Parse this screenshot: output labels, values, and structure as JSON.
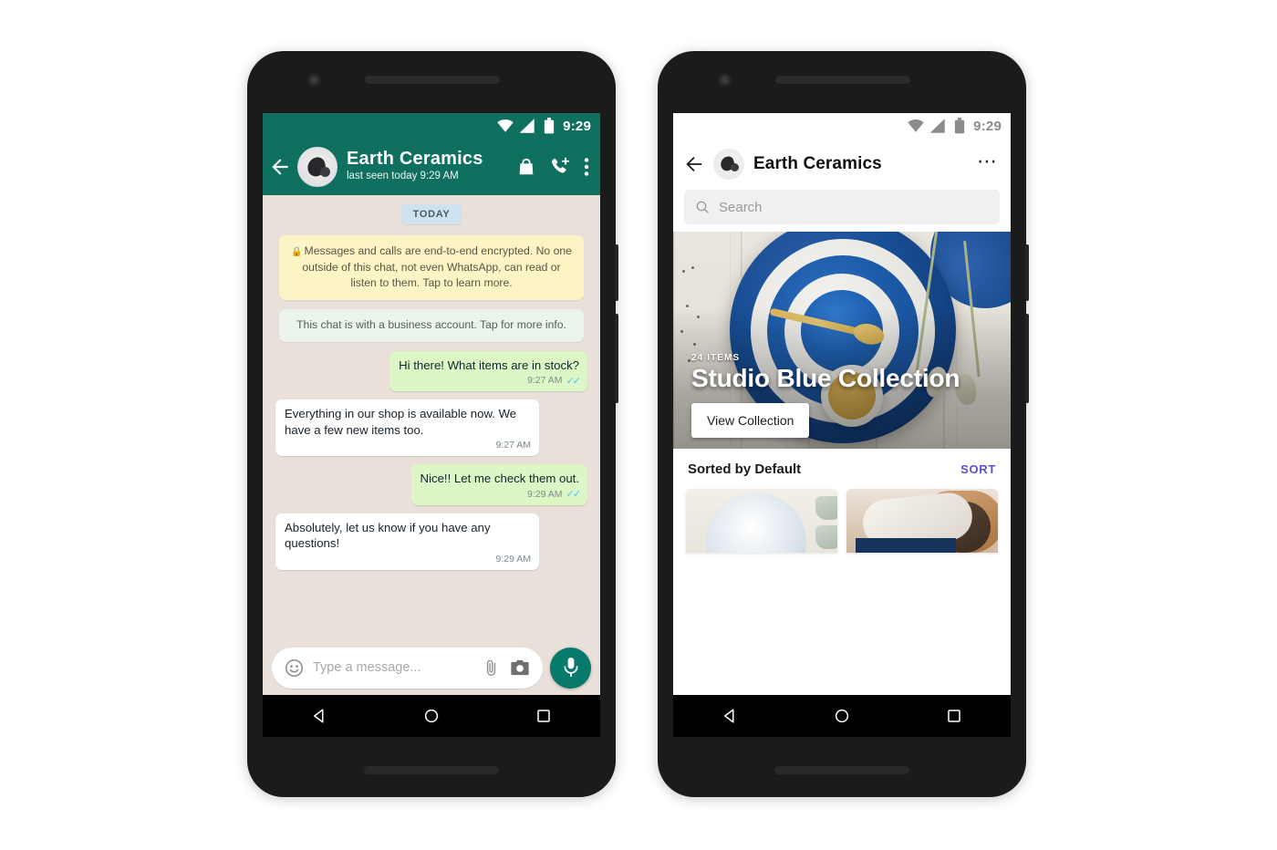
{
  "left_phone": {
    "status_bar": {
      "time": "9:29",
      "icons": [
        "wifi-icon",
        "cellular-icon",
        "battery-icon"
      ]
    },
    "header": {
      "back_icon": "arrow-left-icon",
      "avatar": "contact-avatar",
      "name": "Earth Ceramics",
      "subtitle": "last seen today 9:29 AM",
      "actions": [
        "shop-bag-icon",
        "video-call-add-icon",
        "overflow-menu-icon"
      ]
    },
    "chat": {
      "day_divider": "TODAY",
      "system_messages": [
        {
          "type": "encryption",
          "icon": "lock-icon",
          "text": "Messages and calls are end-to-end encrypted. No one outside of this chat, not even WhatsApp, can read or listen to them. Tap to learn more."
        },
        {
          "type": "business",
          "text": "This chat is with a business account. Tap for more info."
        }
      ],
      "messages": [
        {
          "direction": "out",
          "text": "Hi there! What items are in stock?",
          "time": "9:27 AM",
          "status": "read"
        },
        {
          "direction": "in",
          "text": "Everything in our shop is available now. We have a few new items too.",
          "time": "9:27 AM",
          "status": ""
        },
        {
          "direction": "out",
          "text": "Nice!! Let me check them out.",
          "time": "9:29 AM",
          "status": "read"
        },
        {
          "direction": "in",
          "text": "Absolutely, let us know if you have any questions!",
          "time": "9:29 AM",
          "status": ""
        }
      ]
    },
    "composer": {
      "emoji_icon": "emoji-smiley-icon",
      "placeholder": "Type a message...",
      "attach_icon": "paperclip-icon",
      "camera_icon": "camera-icon",
      "mic_icon": "microphone-icon"
    },
    "nav_bar": [
      "back-triangle-icon",
      "home-circle-icon",
      "recents-square-icon"
    ]
  },
  "right_phone": {
    "status_bar": {
      "time": "9:29",
      "icons": [
        "wifi-icon",
        "cellular-icon",
        "battery-icon"
      ]
    },
    "header": {
      "back_icon": "arrow-left-icon",
      "avatar": "business-avatar",
      "title": "Earth Ceramics",
      "overflow_icon": "overflow-dots-icon"
    },
    "search": {
      "icon": "search-icon",
      "placeholder": "Search",
      "value": ""
    },
    "hero": {
      "items_count": "24 ITEMS",
      "title": "Studio Blue Collection",
      "button_label": "View Collection",
      "image_alt": "stacked blue and white ceramic bowls with a gold spoon"
    },
    "sort": {
      "label": "Sorted by Default",
      "action": "SORT",
      "action_color": "#5b51c8"
    },
    "products": [
      {
        "image_alt": "pale blue ceramic bowl with two green cups"
      },
      {
        "image_alt": "hands holding a ceramic bowl"
      }
    ],
    "nav_bar": [
      "back-triangle-icon",
      "home-circle-icon",
      "recents-square-icon"
    ]
  },
  "theme": {
    "whatsapp_green": "#0f7060",
    "outgoing_bubble": "#dcf6c6",
    "incoming_bubble": "#ffffff",
    "chat_background": "#e9e0d9",
    "encryption_notice": "#fcf4c5",
    "business_notice": "#eaf4ea",
    "mic_button": "#077a6b",
    "sort_accent": "#5b51c8"
  }
}
